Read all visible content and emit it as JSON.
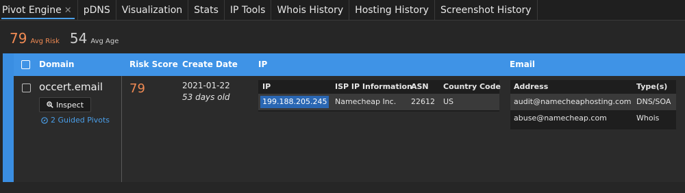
{
  "tabs": [
    {
      "label": "Pivot Engine",
      "active": true,
      "closable": true
    },
    {
      "label": "pDNS"
    },
    {
      "label": "Visualization"
    },
    {
      "label": "Stats"
    },
    {
      "label": "IP Tools"
    },
    {
      "label": "Whois History"
    },
    {
      "label": "Hosting History"
    },
    {
      "label": "Screenshot History"
    }
  ],
  "summary": {
    "avg_risk_value": "79",
    "avg_risk_label": "Avg Risk",
    "avg_age_value": "54",
    "avg_age_label": "Avg Age"
  },
  "columns": {
    "domain": "Domain",
    "risk_score": "Risk Score",
    "create_date": "Create Date",
    "ip": "IP",
    "email": "Email"
  },
  "row": {
    "domain": "occert.email",
    "inspect_label": "Inspect",
    "guided_pivots": "2 Guided Pivots",
    "risk_score": "79",
    "create_date": "2021-01-22",
    "age": "53 days old",
    "ip_table": {
      "headers": [
        "IP",
        "ISP IP Information",
        "ASN",
        "Country Code"
      ],
      "rows": [
        {
          "ip": "199.188.205.245",
          "isp": "Namecheap Inc.",
          "asn": "22612",
          "country": "US"
        }
      ]
    },
    "email_table": {
      "headers": [
        "Address",
        "Type(s)"
      ],
      "rows": [
        {
          "address": "audit@namecheaphosting.com",
          "type": "DNS/SOA"
        },
        {
          "address": "abuse@namecheap.com",
          "type": "Whois"
        }
      ]
    }
  },
  "colors": {
    "accent_blue": "#3f93e6",
    "risk_orange": "#f08a53",
    "link_blue": "#4a9fea"
  }
}
